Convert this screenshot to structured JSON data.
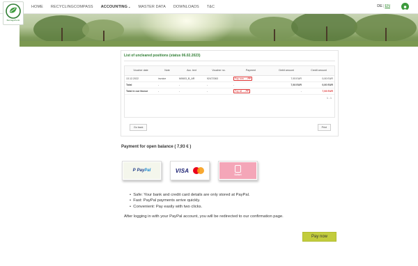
{
  "header": {
    "logo_text": "BeitragsPunkt",
    "nav": [
      {
        "label": "HOME",
        "active": false
      },
      {
        "label": "RECYCLINGCOMPASS",
        "active": false
      },
      {
        "label": "ACCOUNTING",
        "active": true,
        "has_dropdown": true
      },
      {
        "label": "MASTER DATA",
        "active": false
      },
      {
        "label": "DOWNLOADS",
        "active": false
      },
      {
        "label": "T&C",
        "active": false
      }
    ],
    "lang": {
      "de": "DE",
      "sep": "|",
      "en": "EN"
    },
    "accent_color": "#3c9a3c"
  },
  "positions": {
    "title": "List of uncleared positions (status 06.02.2023)",
    "columns": [
      "Voucher date",
      "Note",
      "Acc. text",
      "Voucher no.",
      "Payment",
      "Debit amount",
      "Credit amount"
    ],
    "rows": [
      {
        "date": "13.12.2022",
        "note": "invoice",
        "acc_text": "M0603_B_AR",
        "voucher": "92472363",
        "payment": "Pay now →",
        "debit": "7,93 EUR",
        "credit": "0,00 EUR"
      }
    ],
    "total": {
      "label": "Total",
      "note": "-",
      "acc_text": "-",
      "voucher": "-",
      "payment": "-",
      "debit": "7,93 EUR",
      "credit": "0,00 EUR"
    },
    "favour": {
      "label": "Total in our favour",
      "note": "-",
      "acc_text": "-",
      "voucher": "-",
      "payment": "Pay all →",
      "debit": "-",
      "credit": "7,93 EUR"
    },
    "pager": "1 - 1",
    "back_label": "Go back",
    "print_label": "Print"
  },
  "payment": {
    "balance_label": "Payment for open balance ( 7,93 € )",
    "methods": [
      {
        "name": "PayPal",
        "icon": "paypal-logo"
      },
      {
        "name": "VISA",
        "icon": "visa-mastercard-logo"
      },
      {
        "name": "Sofort",
        "icon": "sofort-logo"
      }
    ],
    "bullets": [
      "Safe: Your bank and credit card details are only stored at PayPal.",
      "Fast: PayPal payments arrive quickly.",
      "Convenient: Pay easily with two clicks."
    ],
    "redirect_note": "After logging in with your PayPal account, you will be redirected to our confirmation page.",
    "pay_now_label": "Pay now",
    "pay_button_color": "#c2cc3c"
  }
}
